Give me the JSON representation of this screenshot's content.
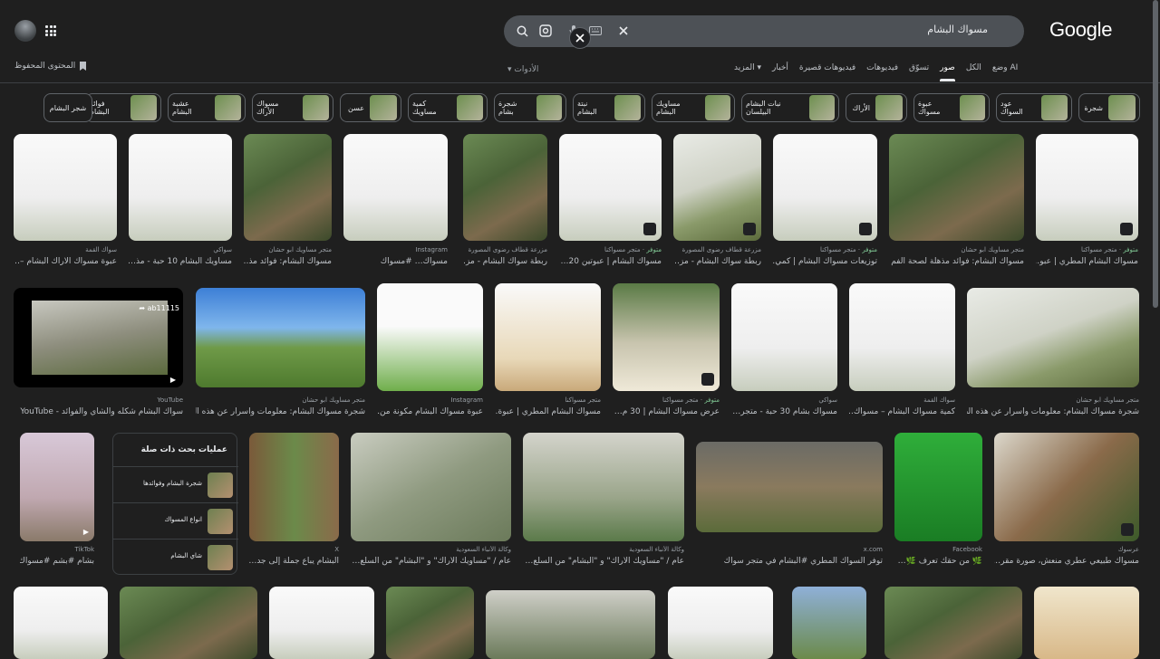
{
  "header": {
    "logo": "Google",
    "search_query": "مسواك البشام",
    "saved_label": "المحتوى المحفوظ",
    "tools_label": "الأدوات"
  },
  "nav": {
    "tabs": [
      {
        "label": "وضع AI"
      },
      {
        "label": "الكل"
      },
      {
        "label": "صور",
        "active": true
      },
      {
        "label": "تسوّق"
      },
      {
        "label": "فيديوهات"
      },
      {
        "label": "فيديوهات قصيرة"
      },
      {
        "label": "أخبار"
      },
      {
        "label": "المزيد"
      }
    ]
  },
  "chips": [
    "شجرة",
    "عود السواك",
    "عبوة مسواك",
    "الأراك",
    "نبات البشام البيلسان",
    "مساويك البشام",
    "نبتة البشام",
    "شجرة بشام",
    "كمية مساويك",
    "عسن",
    "مسواك الأراك",
    "عشبة البشام",
    "فوائد البشام",
    "شجر البشام"
  ],
  "results": [
    {
      "src": "متجر مسواكنا",
      "title": "مسواك البشام المطري | عبو…",
      "tag": "متوفر"
    },
    {
      "src": "متجر مساويك ابو حشان",
      "title": "مسواك البشام: فوائد مذهلة لصحة الفم"
    },
    {
      "src": "متجر مسواكنا",
      "title": "توزيعات مسواك البشام | كمي…",
      "tag": "متوفر"
    },
    {
      "src": "مزرعة قطاف رضوى المصورة",
      "title": "ربطة سواك البشام - مز…"
    },
    {
      "src": "متجر مسواكنا",
      "title": "مسواك البشام | عبوتين 20…",
      "tag": "متوفر"
    },
    {
      "src": "مزرعة قطاف رضوى المصورة",
      "title": "ربطة سواك البشام - مز…"
    },
    {
      "src": "Instagram",
      "title": "مسواك… #مسواك"
    },
    {
      "src": "متجر مساويك ابو حشان",
      "title": "مسواك البشام: فوائد مذ…"
    },
    {
      "src": "سواكي",
      "title": "مساويك البشام 10 حبة - مذ…"
    },
    {
      "src": "سواك القمة",
      "title": "عبوة مسواك الاراك البشام –…"
    },
    {
      "src": "متجر مساويك ابو حشان",
      "title": "شجرة مسواك البشام: معلومات وأسرار عن هذه الت…"
    },
    {
      "src": "سواك القمة",
      "title": "كمية مسواك البشام – مسواك…"
    },
    {
      "src": "سواكي",
      "title": "مسواك بشام 30 حبة - متجر…"
    },
    {
      "src": "متجر مسواكنا",
      "title": "عرض مسواك البشام | 30 م…",
      "tag": "متوفر"
    },
    {
      "src": "متجر مسواكنا",
      "title": "مسواك البشام المطري | عبوة…"
    },
    {
      "src": "Instagram",
      "title": "عبوة مسواك البشام مكونة من…"
    },
    {
      "src": "متجر مساويك ابو حشان",
      "title": "شجرة مسواك البشام: معلومات وأسرار عن هذه ال…"
    },
    {
      "src": "YouTube",
      "title": "سواك البشام شكله والشاي والفوائد - YouTube"
    },
    {
      "src": "عرسوك",
      "title": "مسواك طبيعي عطري منعش، صورة مقر…"
    },
    {
      "src": "Facebook",
      "title": "🌿 من حقك تعرف 🌿…"
    },
    {
      "src": "x.com",
      "title": "توفر السواك المطري #البشام في متجر سواك"
    },
    {
      "src": "وكالة الأنباء السعودية",
      "title": "عام / \"مساويك الأراك\" و \"البشام\" من السلع…"
    },
    {
      "src": "وكالة الأنباء السعودية",
      "title": "عام / \"مساويك الأراك\" و \"البشام\" من السلع…"
    },
    {
      "src": "X",
      "title": "البشام يباع جملة إلى جد…"
    },
    {
      "src": "TikTok",
      "title": "بشام #بشم #مسواك #…"
    }
  ],
  "related": {
    "title": "عمليات بحث ذات صلة",
    "items": [
      {
        "label": "شجرة البشام وفوائدها"
      },
      {
        "label": "انواع المسواك"
      },
      {
        "label": "شاي البشام"
      }
    ]
  },
  "video_overlay": "ab11115"
}
